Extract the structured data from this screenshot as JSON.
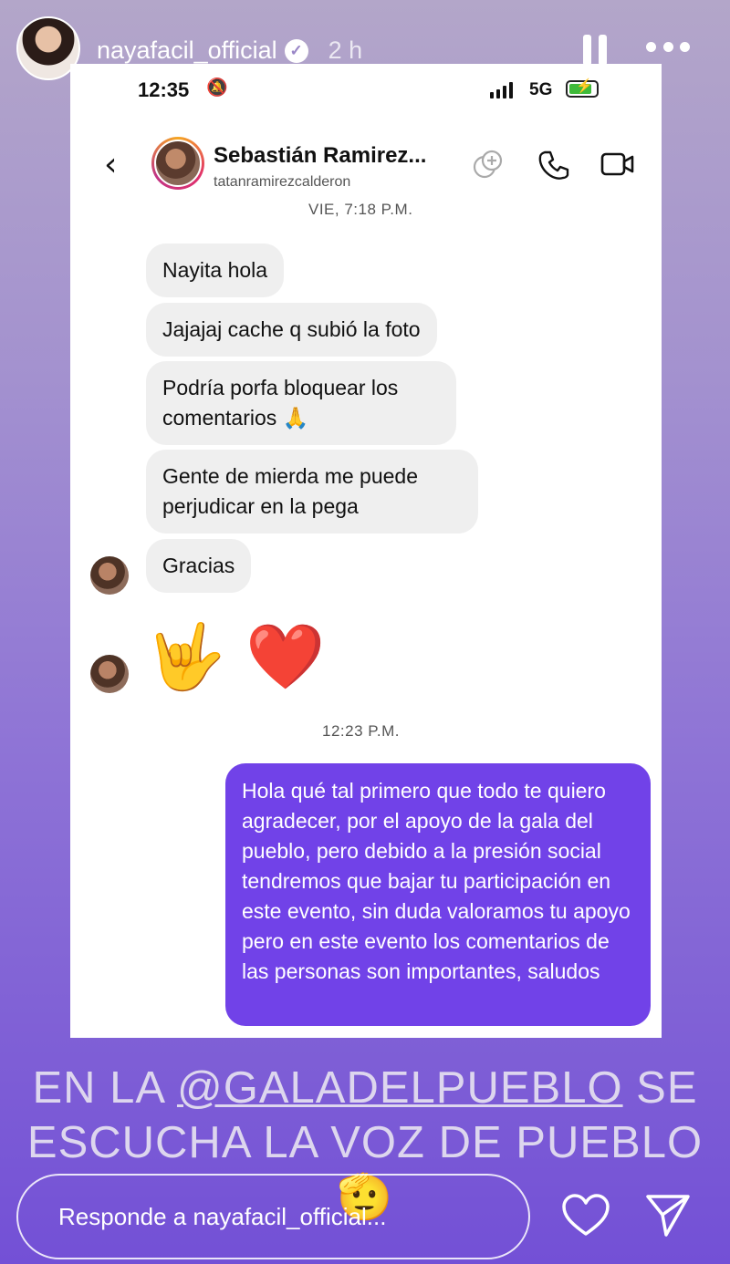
{
  "story": {
    "username": "nayafacil_official",
    "time": "2 h",
    "verified_mark": "✓",
    "icons": [
      "pause-icon",
      "more-icon",
      "verified-icon"
    ]
  },
  "screenshot": {
    "status_bar": {
      "time": "12:35",
      "mute_icon": "🔕",
      "network": "5G",
      "battery_level": 0.85,
      "battery_color": "#3fba3a"
    },
    "dm_header": {
      "contact_name": "Sebastián Ramirez...",
      "contact_handle": "tatanramirezcalderon",
      "icons": [
        "back-icon",
        "effects-icon",
        "phone-icon",
        "video-icon"
      ]
    },
    "timestamp_1": "VIE, 7:18 P.M.",
    "incoming": [
      {
        "text": "Nayita hola"
      },
      {
        "text": "Jajajaj cache q subió la foto"
      },
      {
        "text": "Podría porfa bloquear los comentarios 🙏"
      },
      {
        "text": "Gente de mierda me puede perjudicar en la pega"
      },
      {
        "text": "Gracias"
      }
    ],
    "emoji_message": "🤟 ❤️",
    "timestamp_2": "12:23 P.M.",
    "outgoing": "Hola qué tal primero que todo te quiero agradecer, por el apoyo de la gala del pueblo, pero debido a la presión social tendremos que bajar tu participación en este evento, sin duda valoramos tu apoyo pero en este evento los comentarios de las personas son importantes, saludos",
    "outgoing_color": "#7142e8"
  },
  "caption": {
    "prefix": "EN LA ",
    "mention": "@GALADELPUEBLO",
    "suffix": " SE",
    "line2": "ESCUCHA LA VOZ DE PUEBLO 🫡"
  },
  "reply": {
    "placeholder": "Responde a nayafacil_official...",
    "icons": [
      "heart-icon",
      "send-icon"
    ]
  }
}
